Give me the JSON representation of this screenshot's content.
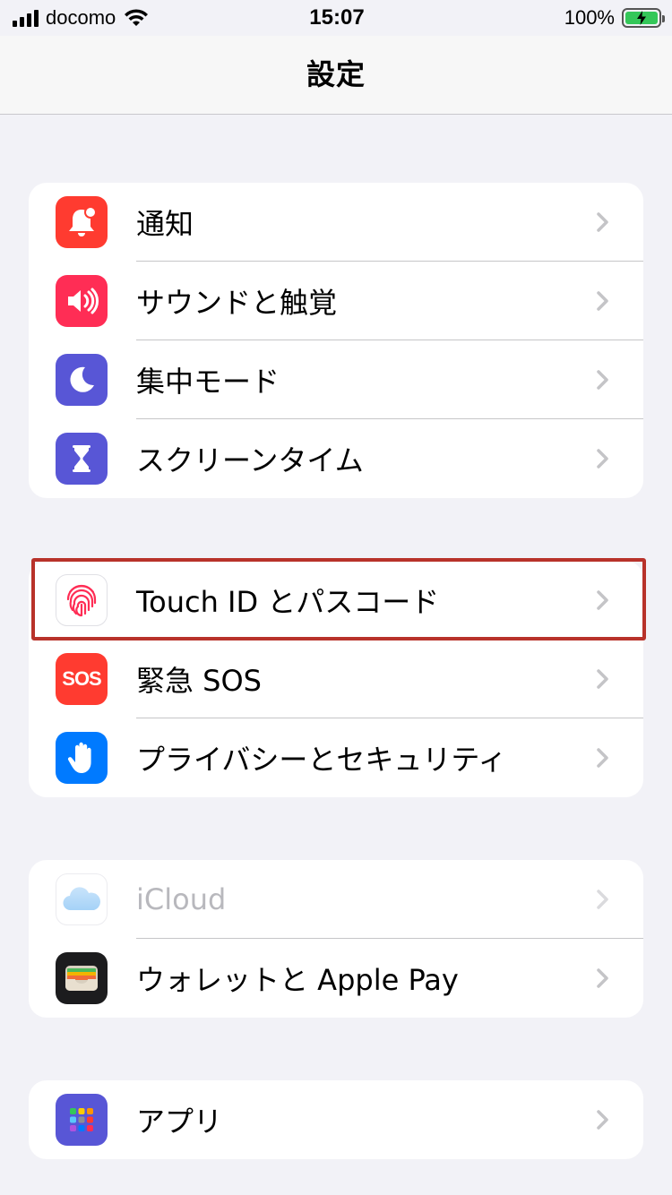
{
  "status_bar": {
    "carrier": "docomo",
    "time": "15:07",
    "battery": "100%"
  },
  "nav": {
    "title": "設定"
  },
  "groups": [
    {
      "items": [
        {
          "label": "通知",
          "icon": "bell-icon",
          "color": "#ff3b30"
        },
        {
          "label": "サウンドと触覚",
          "icon": "speaker-icon",
          "color": "#ff2d55"
        },
        {
          "label": "集中モード",
          "icon": "moon-icon",
          "color": "#5856d6"
        },
        {
          "label": "スクリーンタイム",
          "icon": "hourglass-icon",
          "color": "#5856d6"
        }
      ]
    },
    {
      "items": [
        {
          "label": "Touch ID とパスコード",
          "icon": "fingerprint-icon",
          "color": "#ffffff"
        },
        {
          "label": "緊急 SOS",
          "icon": "sos-icon",
          "color": "#ff3b30",
          "icon_text": "SOS"
        },
        {
          "label": "プライバシーとセキュリティ",
          "icon": "hand-icon",
          "color": "#007aff"
        }
      ]
    },
    {
      "items": [
        {
          "label": "iCloud",
          "icon": "cloud-icon",
          "color": "#ffffff",
          "disabled": true
        },
        {
          "label": "ウォレットと Apple Pay",
          "icon": "wallet-icon",
          "color": "#1c1c1e"
        }
      ]
    },
    {
      "items": [
        {
          "label": "アプリ",
          "icon": "apps-grid-icon",
          "color": "#5856d6"
        }
      ]
    }
  ],
  "highlight_color": "#b8322a"
}
